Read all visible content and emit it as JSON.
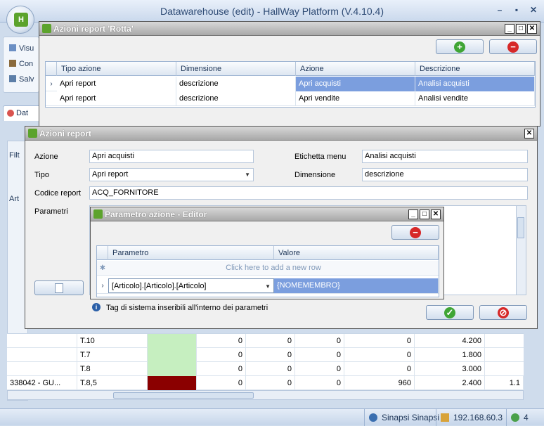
{
  "main": {
    "title": "Datawarehouse (edit) - HallWay Platform (V.4.10.4)",
    "ribbon": [
      "Visu",
      "Con",
      "Salv"
    ],
    "tab": "Dat",
    "left_labels": [
      "Filt",
      "Art"
    ]
  },
  "bg_rows": [
    {
      "name": "",
      "col": "T.10",
      "v": [
        "0",
        "0",
        "0",
        "0",
        "4.200"
      ],
      "color": "#c6efc0"
    },
    {
      "name": "",
      "col": "T.7",
      "v": [
        "0",
        "0",
        "0",
        "0",
        "1.800"
      ],
      "color": "#c6efc0"
    },
    {
      "name": "",
      "col": "T.8",
      "v": [
        "0",
        "0",
        "0",
        "0",
        "3.000"
      ],
      "color": "#c6efc0"
    },
    {
      "name": "338042 - GU...",
      "col": "T.8,5",
      "v": [
        "0",
        "0",
        "0",
        "960",
        "2.400"
      ],
      "color": "#8b0000"
    }
  ],
  "bg_tail": "1.1",
  "status": {
    "user": "Sinapsi Sinapsi",
    "ip": "192.168.60.3",
    "count": "4"
  },
  "dlg1": {
    "title": "Azioni report 'Rotta'",
    "cols": [
      "Tipo azione",
      "Dimensione",
      "Azione",
      "Descrizione"
    ],
    "rows": [
      [
        "Apri report",
        "descrizione",
        "Apri acquisti",
        "Analisi acquisti"
      ],
      [
        "Apri report",
        "descrizione",
        "Apri vendite",
        "Analisi vendite"
      ]
    ]
  },
  "dlg2": {
    "title": "Azioni report",
    "azione_label": "Azione",
    "azione": "Apri acquisti",
    "tipo_label": "Tipo",
    "tipo": "Apri report",
    "etichetta_label": "Etichetta menu",
    "etichetta": "Analisi acquisti",
    "dimensione_label": "Dimensione",
    "dimensione": "descrizione",
    "codice_label": "Codice report",
    "codice": "ACQ_FORNITORE",
    "parametri_label": "Parametri",
    "info": "Tag di sistema inseribili all'interno dei parametri"
  },
  "dlg3": {
    "title": "Parametro azione - Editor",
    "cols": [
      "Parametro",
      "Valore"
    ],
    "add_row": "Click here to add a new row",
    "param": "[Articolo].[Articolo].[Articolo]",
    "valore": "{NOMEMEMBRO}"
  }
}
